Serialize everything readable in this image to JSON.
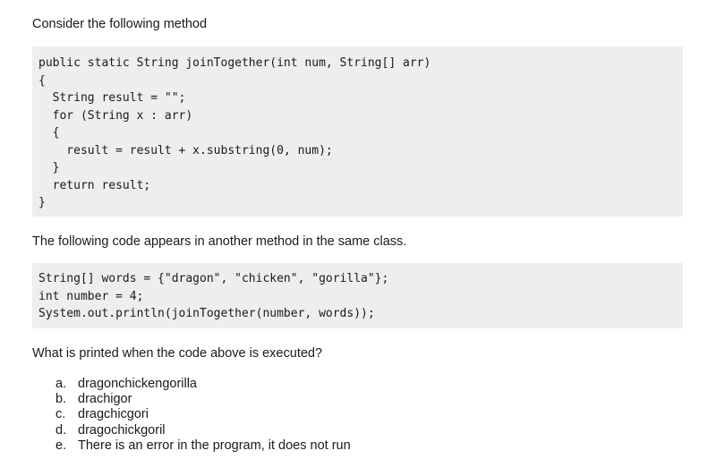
{
  "intro": "Consider the following method",
  "method_code": [
    "public static String joinTogether(int num, String[] arr)",
    "{",
    "  String result = \"\";",
    "  for (String x : arr)",
    "  {",
    "    result = result + x.substring(0, num);",
    "  }",
    "  return result;",
    "}"
  ],
  "second_intro": "The following code appears in another method in the same class.",
  "call_code": [
    "String[] words = {\"dragon\", \"chicken\", \"gorilla\"};",
    "int number = 4;",
    "System.out.println(joinTogether(number, words));"
  ],
  "question": "What is printed when the code above is executed?",
  "options": [
    {
      "letter": "a.",
      "text": "dragonchickengorilla"
    },
    {
      "letter": "b.",
      "text": "drachigor"
    },
    {
      "letter": "c.",
      "text": "dragchicgori"
    },
    {
      "letter": "d.",
      "text": "dragochickgoril"
    },
    {
      "letter": "e.",
      "text": "There is an error in the program, it does not run"
    }
  ]
}
